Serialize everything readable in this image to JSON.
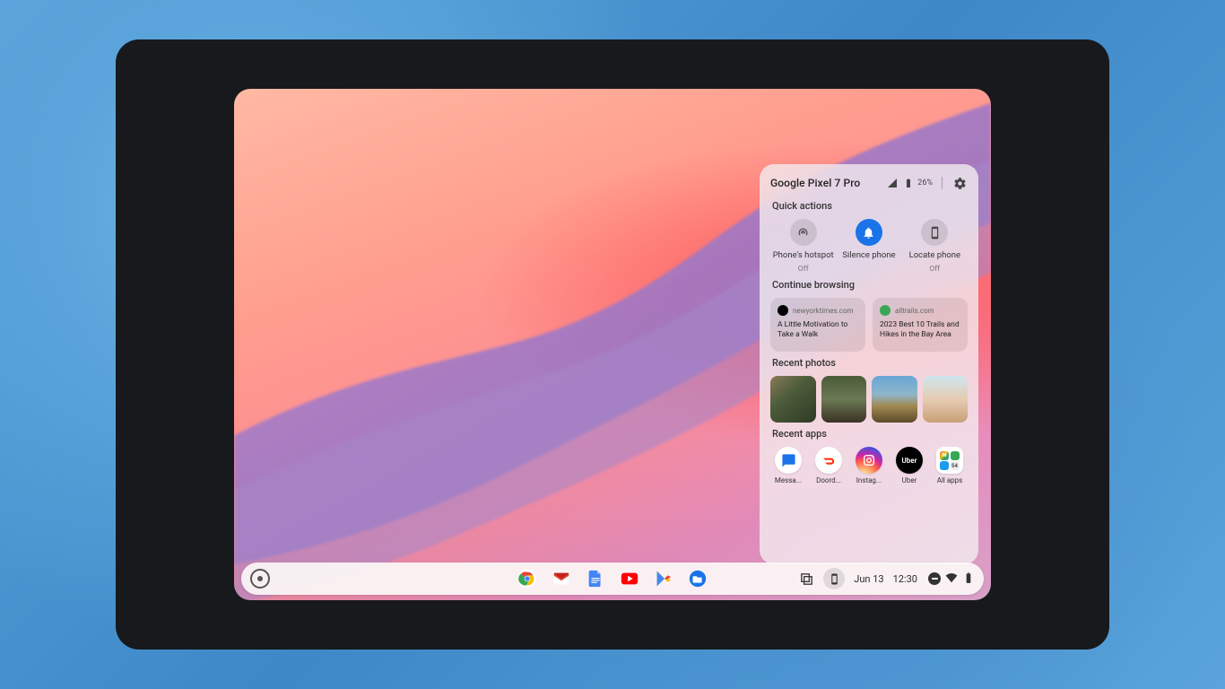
{
  "phone_hub": {
    "phone_name": "Google Pixel 7 Pro",
    "battery_pct": "26%",
    "sections": {
      "quick_actions": "Quick actions",
      "continue_browsing": "Continue browsing",
      "recent_photos": "Recent photos",
      "recent_apps": "Recent apps"
    },
    "quick_actions": [
      {
        "label": "Phone's hotspot",
        "sub": "Off",
        "icon": "hotspot",
        "active": false
      },
      {
        "label": "Silence phone",
        "sub": "",
        "icon": "bell",
        "active": true
      },
      {
        "label": "Locate phone",
        "sub": "Off",
        "icon": "locate",
        "active": false
      }
    ],
    "browsing": [
      {
        "site": "newyorktimes.com",
        "title": "A Little Motivation to Take a Walk",
        "fav": "nyt"
      },
      {
        "site": "alltrails.com",
        "title": "2023 Best 10 Trails and Hikes in the Bay Area",
        "fav": "alltrails"
      }
    ],
    "recent_apps": [
      {
        "name": "Messa...",
        "icon": "messages"
      },
      {
        "name": "Doord...",
        "icon": "doordash"
      },
      {
        "name": "Instag...",
        "icon": "instagram"
      },
      {
        "name": "Uber",
        "icon": "uber"
      },
      {
        "name": "All apps",
        "icon": "allapps"
      }
    ]
  },
  "shelf": {
    "pinned": [
      {
        "name": "chrome"
      },
      {
        "name": "gmail"
      },
      {
        "name": "docs"
      },
      {
        "name": "youtube"
      },
      {
        "name": "play-store"
      },
      {
        "name": "files"
      }
    ],
    "date": "Jun 13",
    "time": "12:30"
  }
}
